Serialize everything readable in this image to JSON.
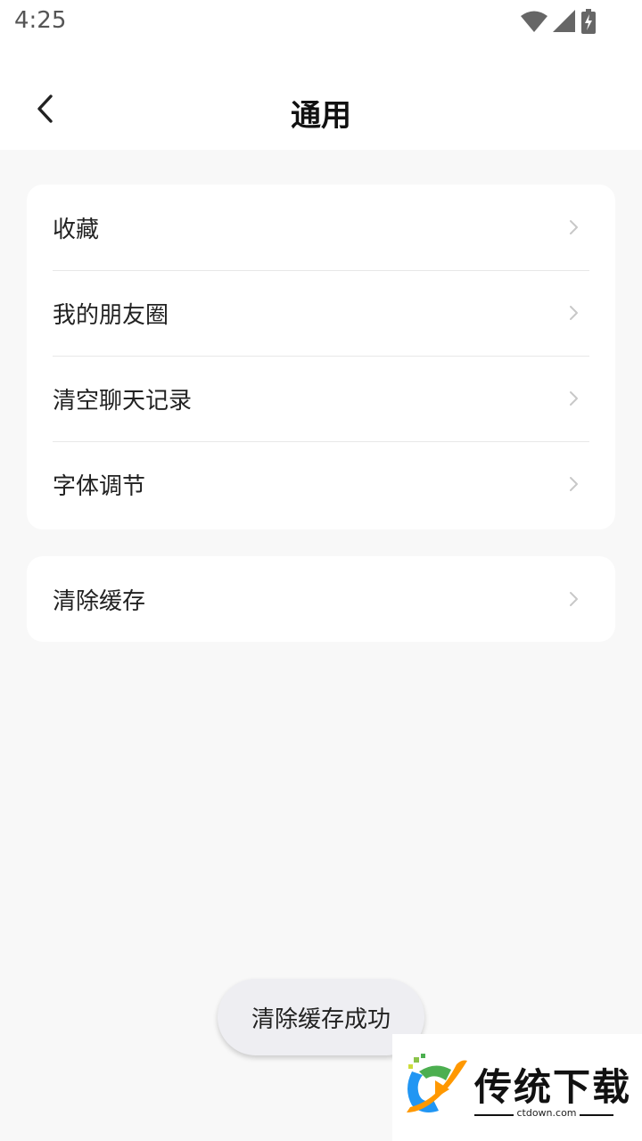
{
  "status_bar": {
    "time": "4:25",
    "icons": [
      "wifi-icon",
      "signal-icon",
      "battery-charging-icon"
    ]
  },
  "header": {
    "title": "通用",
    "back_icon": "chevron-left-icon"
  },
  "settings_group_1": {
    "items": [
      {
        "label": "收藏"
      },
      {
        "label": "我的朋友圈"
      },
      {
        "label": "清空聊天记录"
      },
      {
        "label": "字体调节"
      }
    ]
  },
  "settings_group_2": {
    "items": [
      {
        "label": "清除缓存"
      }
    ]
  },
  "toast": {
    "message": "清除缓存成功"
  },
  "watermark": {
    "title": "传统下载",
    "domain": "ctdown.com"
  },
  "colors": {
    "page_background": "#f8f8f8",
    "card_background": "#ffffff",
    "chevron": "#c8c8c8",
    "toast_background": "#eeeef2"
  }
}
